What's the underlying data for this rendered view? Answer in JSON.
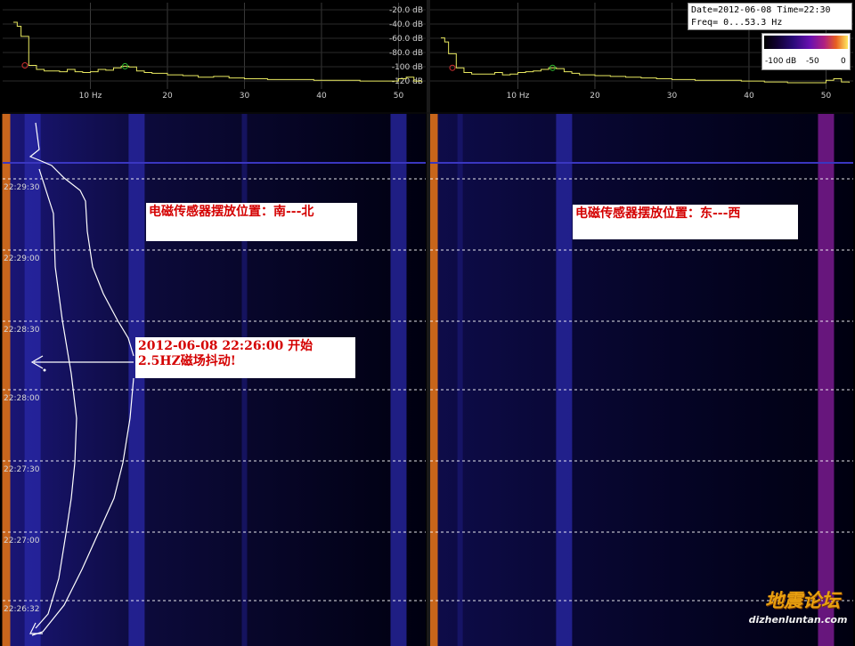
{
  "info": {
    "line1": "Date=2012-06-08 Time=22:30",
    "line2": "Freq= 0...53.3 Hz"
  },
  "colorbar": {
    "labels": [
      "-100 dB",
      "-50",
      "0"
    ],
    "gradient": [
      "#000000",
      "#2a0a7a",
      "#6a10b0",
      "#b02080",
      "#e86020",
      "#ffe860"
    ]
  },
  "annotations": {
    "left_panel": "电磁传感器摆放位置：南---北",
    "right_panel": "电磁传感器摆放位置：东---西",
    "event_line1": "2012-06-08  22:26:00 开始",
    "event_line2": "2.5HZ磁场抖动!"
  },
  "watermark": {
    "title": "地震论坛",
    "url": "dizhenluntan.com"
  },
  "colors": {
    "trace": "#e8e860",
    "gridline": "#ffffff",
    "annotation_text": "#d40000",
    "band_orange": "#d26a18",
    "band_blue": "#2a28a8",
    "band_magenta": "#8a1ea0"
  },
  "chart_data": [
    {
      "type": "line",
      "title": "",
      "x_ticks": [
        "10 Hz",
        "20",
        "30",
        "40",
        "50"
      ],
      "y_ticks": [
        "-20.0 dB",
        "-40.0 dB",
        "-60.0 dB",
        "-80.0 dB",
        "-100 dB",
        "-120 dB"
      ],
      "xlim": [
        0,
        53.3
      ],
      "ylim": [
        -125,
        -15
      ],
      "series": [
        {
          "x": [
            0,
            0.5,
            1,
            2,
            3,
            4,
            6,
            7,
            8,
            9,
            10,
            11,
            12,
            13,
            14,
            15,
            16,
            17,
            18,
            20,
            22,
            24,
            26,
            28,
            30,
            33,
            36,
            39,
            42,
            45,
            48,
            50,
            51,
            52,
            53
          ],
          "y": [
            -40,
            -45,
            -58,
            -95,
            -100,
            -102,
            -103,
            -100,
            -103,
            -104,
            -103,
            -100,
            -101,
            -98,
            -96,
            -97,
            -102,
            -104,
            -105,
            -107,
            -108,
            -110,
            -109,
            -111,
            -112,
            -113,
            -113,
            -114,
            -114,
            -115,
            -115,
            -112,
            -110,
            -115,
            -116
          ]
        }
      ]
    },
    {
      "type": "line",
      "title": "",
      "x_ticks": [
        "10 Hz",
        "20",
        "30",
        "40",
        "50"
      ],
      "y_ticks": [
        "-20.0 dB",
        "-40.0 dB",
        "-60.0 dB",
        "-80.0 dB",
        "-100 dB",
        "-120 dB"
      ],
      "xlim": [
        0,
        53.3
      ],
      "ylim": [
        -125,
        -15
      ],
      "series": [
        {
          "x": [
            0,
            0.5,
            1,
            2,
            3,
            4,
            6,
            7,
            8,
            9,
            10,
            11,
            12,
            13,
            14,
            15,
            16,
            17,
            18,
            20,
            22,
            24,
            26,
            28,
            30,
            33,
            36,
            39,
            42,
            45,
            48,
            50,
            51,
            52,
            53
          ],
          "y": [
            -60,
            -65,
            -80,
            -98,
            -104,
            -106,
            -106,
            -104,
            -107,
            -106,
            -104,
            -103,
            -102,
            -100,
            -98,
            -99,
            -103,
            -105,
            -107,
            -108,
            -109,
            -110,
            -111,
            -112,
            -113,
            -114,
            -114,
            -115,
            -116,
            -117,
            -117,
            -114,
            -112,
            -116,
            -117
          ]
        }
      ]
    },
    {
      "type": "heatmap",
      "title": "",
      "y_ticks": [
        "22:29:30",
        "22:29:00",
        "22:28:30",
        "22:28:00",
        "22:27:30",
        "22:27:00",
        "22:26:32"
      ],
      "xlim": [
        0,
        53.3
      ],
      "bands_hz": [
        {
          "hz": 0.5,
          "level": "high"
        },
        {
          "hz": 2.5,
          "level": "mid"
        },
        {
          "hz": 16,
          "level": "mid"
        },
        {
          "hz": 30,
          "level": "low"
        },
        {
          "hz": 50,
          "level": "mid"
        }
      ]
    },
    {
      "type": "heatmap",
      "title": "",
      "y_ticks": [],
      "xlim": [
        0,
        53.3
      ],
      "bands_hz": [
        {
          "hz": 0.5,
          "level": "high"
        },
        {
          "hz": 2.5,
          "level": "low"
        },
        {
          "hz": 16,
          "level": "mid"
        },
        {
          "hz": 50,
          "level": "mid"
        }
      ]
    }
  ]
}
